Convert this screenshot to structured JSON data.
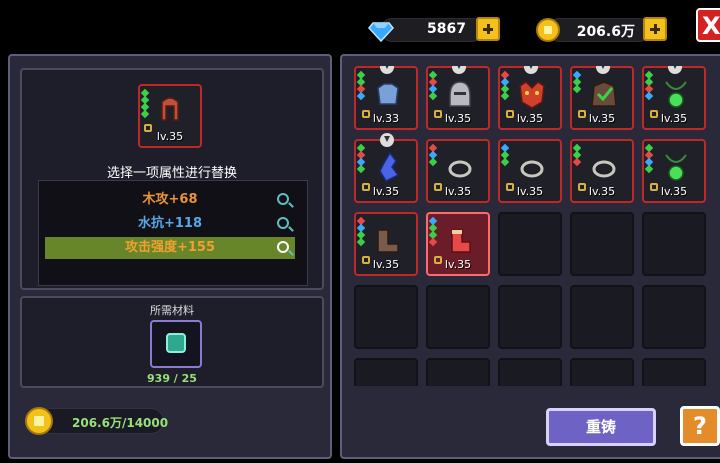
{
  "currency": {
    "gems": "5867",
    "gold": "206.6万"
  },
  "close_label": "X",
  "selected_item": {
    "level": "lv.35",
    "border": "#c02828"
  },
  "select_title": "选择一项属性进行替换",
  "attributes": [
    {
      "label": "木攻+68",
      "color": "#e8943a",
      "selected": false
    },
    {
      "label": "水抗+118",
      "color": "#58a8e8",
      "selected": false
    },
    {
      "label": "攻击强度+155",
      "color": "#f0a030",
      "selected": true
    }
  ],
  "materials": {
    "title": "所需材料",
    "count": "939 / 25"
  },
  "cost": {
    "value": "206.6万/14000"
  },
  "inventory": [
    {
      "level": "lv.33",
      "art": "armor",
      "state": "filled"
    },
    {
      "level": "lv.35",
      "art": "helmet",
      "state": "filled"
    },
    {
      "level": "lv.35",
      "art": "mask",
      "state": "filled"
    },
    {
      "level": "lv.35",
      "art": "cloak",
      "state": "filled"
    },
    {
      "level": "lv.35",
      "art": "amulet",
      "state": "filled"
    },
    {
      "level": "lv.35",
      "art": "crystal",
      "state": "filled"
    },
    {
      "level": "lv.35",
      "art": "ring",
      "state": "filled"
    },
    {
      "level": "lv.35",
      "art": "ring",
      "state": "filled"
    },
    {
      "level": "lv.35",
      "art": "ring",
      "state": "filled"
    },
    {
      "level": "lv.35",
      "art": "amulet",
      "state": "filled"
    },
    {
      "level": "lv.35",
      "art": "boots",
      "state": "filled"
    },
    {
      "level": "lv.35",
      "art": "boots-red",
      "state": "selected"
    }
  ],
  "buttons": {
    "recast": "重铸",
    "help": "?"
  }
}
